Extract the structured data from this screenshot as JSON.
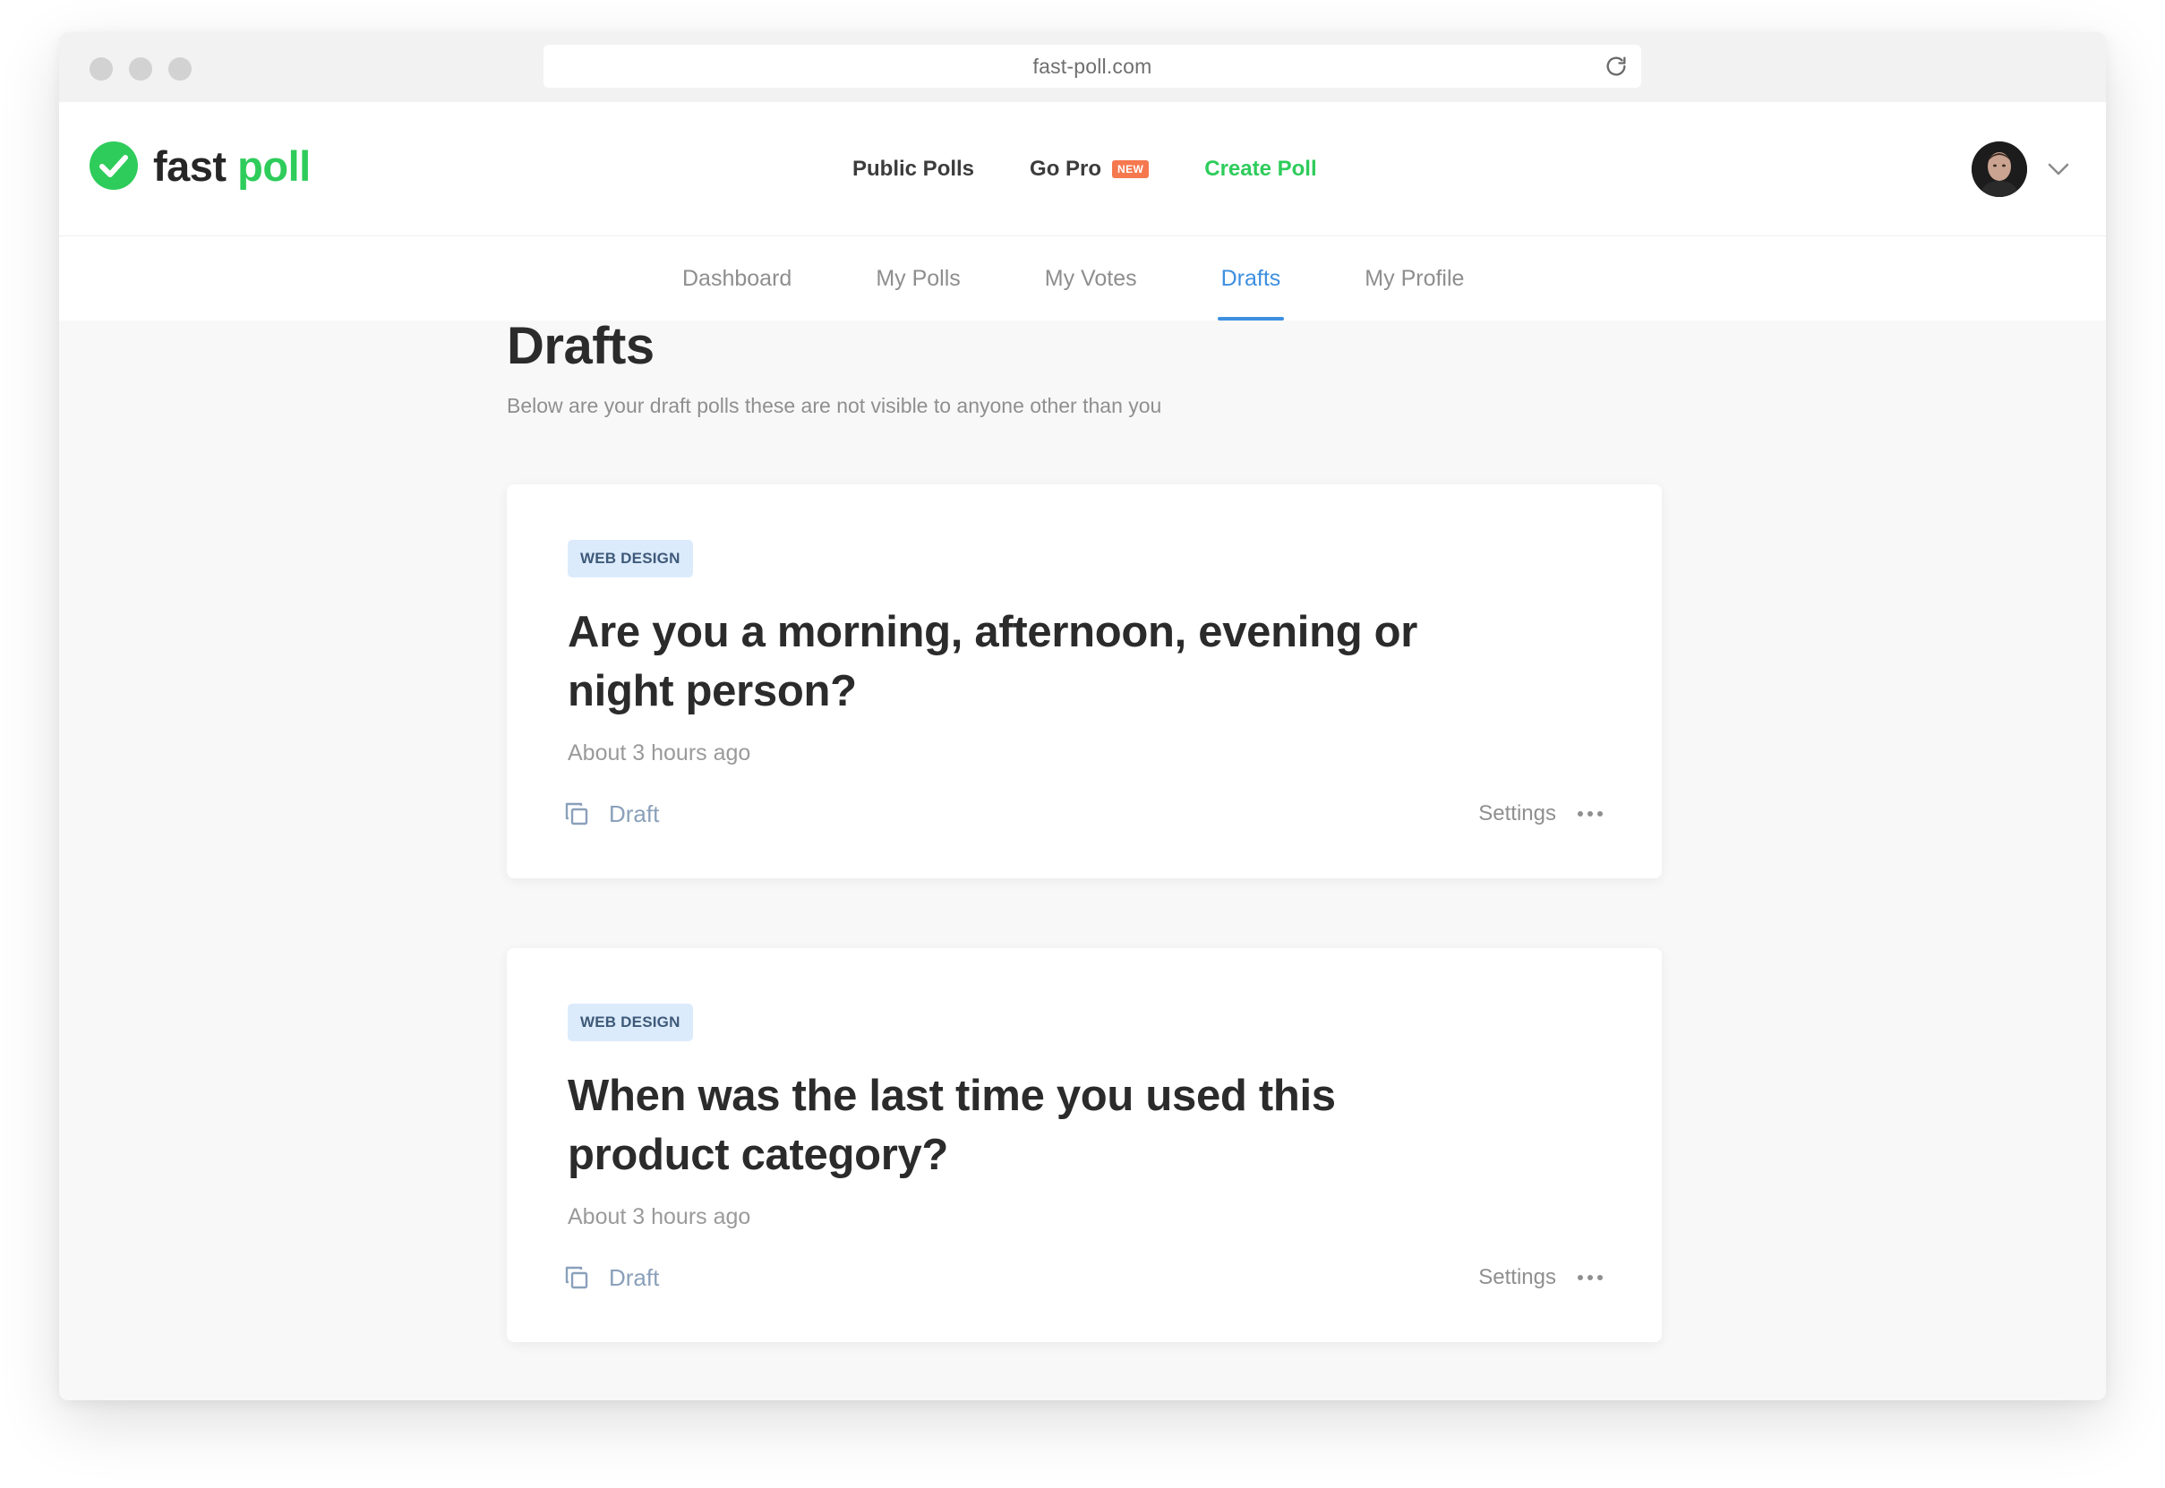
{
  "browser": {
    "url": "fast-poll.com"
  },
  "header": {
    "logo_fast": "fast",
    "logo_poll": "poll",
    "nav": {
      "public_polls": "Public Polls",
      "go_pro": "Go Pro",
      "new_badge": "NEW",
      "create_poll": "Create Poll"
    }
  },
  "subnav": {
    "tabs": [
      {
        "label": "Dashboard",
        "active": false
      },
      {
        "label": "My Polls",
        "active": false
      },
      {
        "label": "My Votes",
        "active": false
      },
      {
        "label": "Drafts",
        "active": true
      },
      {
        "label": "My Profile",
        "active": false
      }
    ]
  },
  "page": {
    "title": "Drafts",
    "subtitle": "Below are your draft polls these are not visible to anyone other than you"
  },
  "polls": [
    {
      "tag": "WEB DESIGN",
      "title": "Are you a morning, afternoon, evening or night person?",
      "time": "About 3 hours ago",
      "status": "Draft",
      "settings_label": "Settings"
    },
    {
      "tag": "WEB DESIGN",
      "title": "When was the last time you used this product category?",
      "time": "About 3 hours ago",
      "status": "Draft",
      "settings_label": "Settings"
    }
  ],
  "colors": {
    "brand_green": "#2ecc5b",
    "active_blue": "#3d8fe0",
    "badge_orange": "#f5784f",
    "tag_bg": "#dcebfb"
  },
  "icons": {
    "logo": "check-circle-icon",
    "reload": "reload-icon",
    "avatar_menu": "chevron-down-icon",
    "status": "copy-icon",
    "more": "more-horizontal-icon"
  }
}
